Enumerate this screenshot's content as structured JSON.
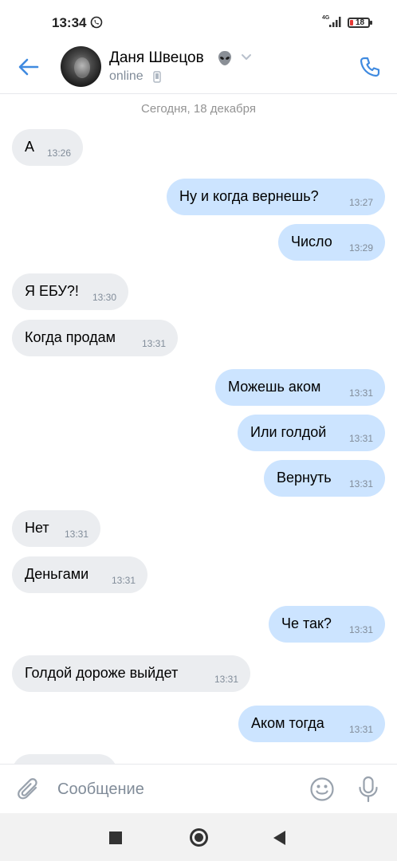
{
  "status_bar": {
    "time": "13:34",
    "network": "4G",
    "battery": "18"
  },
  "header": {
    "contact_name": "Даня Швецов",
    "status": "online",
    "icons": {
      "back": "arrow-left-icon",
      "call": "phone-icon",
      "name_emoji": "alien-icon",
      "dropdown": "chevron-down-icon"
    },
    "accent_color": "#3f8ae0"
  },
  "chat": {
    "date_separator": "Сегодня, 18 декабря",
    "messages": [
      {
        "dir": "in",
        "text": "А",
        "time": "13:26"
      },
      {
        "dir": "out",
        "text": "Ну и когда вернешь?",
        "time": "13:27"
      },
      {
        "dir": "out",
        "text": "Число",
        "time": "13:29"
      },
      {
        "dir": "in",
        "text": "Я ЕБУ?!",
        "time": "13:30"
      },
      {
        "dir": "in",
        "text": "Когда продам",
        "time": "13:31"
      },
      {
        "dir": "out",
        "text": "Можешь аком",
        "time": "13:31"
      },
      {
        "dir": "out",
        "text": "Или голдой",
        "time": "13:31"
      },
      {
        "dir": "out",
        "text": "Вернуть",
        "time": "13:31"
      },
      {
        "dir": "in",
        "text": "Нет",
        "time": "13:31"
      },
      {
        "dir": "in",
        "text": "Деньгами",
        "time": "13:31"
      },
      {
        "dir": "out",
        "text": "Че так?",
        "time": "13:31"
      },
      {
        "dir": "in",
        "text": "Голдой дороже выйдет",
        "time": "13:31"
      },
      {
        "dir": "out",
        "text": "Аком тогда",
        "time": "13:31"
      },
      {
        "dir": "in",
        "text": "",
        "time": ""
      }
    ],
    "colors": {
      "incoming_bubble": "#ebedf0",
      "outgoing_bubble": "#cce4ff"
    }
  },
  "input_bar": {
    "placeholder": "Сообщение",
    "icons": {
      "attach": "paperclip-icon",
      "emoji": "smiley-icon",
      "mic": "microphone-icon"
    }
  },
  "nav_bar": {
    "icons": [
      "recents-square-icon",
      "home-circle-icon",
      "back-triangle-icon"
    ]
  }
}
